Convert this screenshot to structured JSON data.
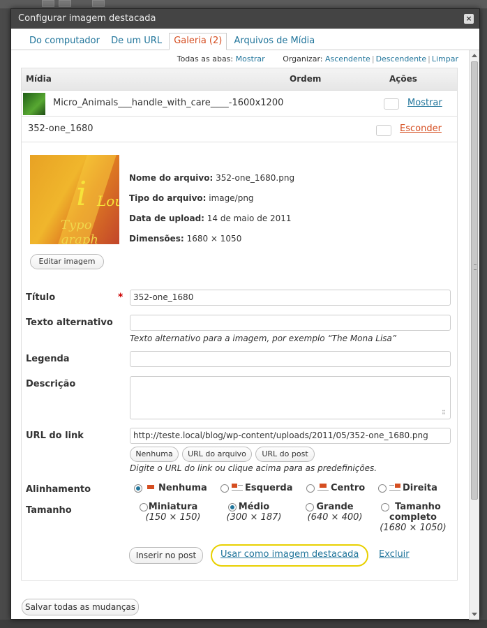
{
  "modal": {
    "title": "Configurar imagem destacada"
  },
  "tabs": [
    {
      "label": "Do computador"
    },
    {
      "label": "De um URL"
    },
    {
      "label": "Galeria (2)"
    },
    {
      "label": "Arquivos de Mídia"
    }
  ],
  "sortbar": {
    "all_tabs_label": "Todas as abas:",
    "show": "Mostrar",
    "organize_label": "Organizar:",
    "asc": "Ascendente",
    "desc": "Descendente",
    "clear": "Limpar"
  },
  "table": {
    "headers": {
      "media": "Mídia",
      "order": "Ordem",
      "actions": "Ações"
    },
    "rows": [
      {
        "title": "Micro_Animals___handle_with_care____-1600x1200",
        "action": "Mostrar"
      },
      {
        "title": "352-one_1680",
        "action": "Esconder"
      }
    ]
  },
  "file": {
    "name_label": "Nome do arquivo:",
    "name": "352-one_1680.png",
    "type_label": "Tipo do arquivo:",
    "type": "image/png",
    "date_label": "Data de upload:",
    "date": "14 de maio de 2011",
    "dims_label": "Dimensões:",
    "dims": "1680 × 1050",
    "edit_button": "Editar imagem",
    "preview_text_1": "i",
    "preview_text_2": "Lou",
    "preview_text_3": "Typo graph"
  },
  "form": {
    "title_label": "Título",
    "title_value": "352-one_1680",
    "required_mark": "*",
    "alt_label": "Texto alternativo",
    "alt_value": "",
    "alt_help": "Texto alternativo para a imagem, por exemplo “The Mona Lisa”",
    "caption_label": "Legenda",
    "caption_value": "",
    "desc_label": "Descrição",
    "desc_value": "",
    "url_label": "URL do link",
    "url_value": "http://teste.local/blog/wp-content/uploads/2011/05/352-one_1680.png",
    "url_none": "Nenhuma",
    "url_file": "URL do arquivo",
    "url_post": "URL do post",
    "url_help": "Digite o URL do link ou clique acima para as predefinições.",
    "align_label": "Alinhamento",
    "align_options": [
      "Nenhuma",
      "Esquerda",
      "Centro",
      "Direita"
    ],
    "size_label": "Tamanho",
    "sizes": [
      {
        "name": "Miniatura",
        "dims": "(150 × 150)"
      },
      {
        "name": "Médio",
        "dims": "(300 × 187)"
      },
      {
        "name": "Grande",
        "dims": "(640 × 400)"
      },
      {
        "name": "Tamanho completo",
        "name_line1": "Tamanho",
        "name_line2": "completo",
        "dims": "(1680 × 1050)"
      }
    ],
    "insert_button": "Inserir no post",
    "featured_link": "Usar como imagem destacada",
    "delete_link": "Excluir"
  },
  "footer": {
    "save_all": "Salvar todas as mudanças"
  },
  "colors": {
    "link": "#21759b",
    "active": "#d54e21",
    "highlight": "#e8d000"
  }
}
